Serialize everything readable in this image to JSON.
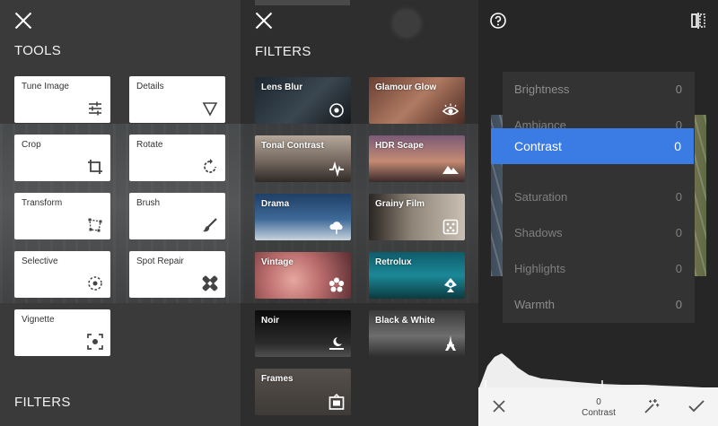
{
  "tools_panel": {
    "heading": "TOOLS",
    "footer_heading": "FILTERS",
    "tools": [
      {
        "label": "Tune Image",
        "icon": "sliders-icon"
      },
      {
        "label": "Details",
        "icon": "triangle-icon"
      },
      {
        "label": "Crop",
        "icon": "crop-icon"
      },
      {
        "label": "Rotate",
        "icon": "rotate-icon"
      },
      {
        "label": "Transform",
        "icon": "transform-icon"
      },
      {
        "label": "Brush",
        "icon": "brush-icon"
      },
      {
        "label": "Selective",
        "icon": "selective-icon"
      },
      {
        "label": "Spot Repair",
        "icon": "bandage-icon"
      },
      {
        "label": "Vignette",
        "icon": "vignette-icon"
      }
    ]
  },
  "filters_panel": {
    "heading": "FILTERS",
    "filters": [
      {
        "label": "Lens Blur",
        "icon": "lens-blur-icon"
      },
      {
        "label": "Glamour Glow",
        "icon": "eye-icon"
      },
      {
        "label": "Tonal Contrast",
        "icon": "pulse-icon"
      },
      {
        "label": "HDR Scape",
        "icon": "mountain-icon"
      },
      {
        "label": "Drama",
        "icon": "cloud-icon"
      },
      {
        "label": "Grainy Film",
        "icon": "grain-icon"
      },
      {
        "label": "Vintage",
        "icon": "flower-icon"
      },
      {
        "label": "Retrolux",
        "icon": "retrolux-icon"
      },
      {
        "label": "Noir",
        "icon": "moon-icon"
      },
      {
        "label": "Black & White",
        "icon": "eiffel-tower-icon"
      },
      {
        "label": "Frames",
        "icon": "frame-icon"
      }
    ]
  },
  "adjust_panel": {
    "items": [
      {
        "label": "Brightness",
        "value": "0"
      },
      {
        "label": "Ambiance",
        "value": "0"
      },
      {
        "label": "Contrast",
        "value": "0"
      },
      {
        "label": "Saturation",
        "value": "0"
      },
      {
        "label": "Shadows",
        "value": "0"
      },
      {
        "label": "Highlights",
        "value": "0"
      },
      {
        "label": "Warmth",
        "value": "0"
      }
    ],
    "active_item": "Contrast",
    "bottom": {
      "value": "0",
      "label": "Contrast"
    }
  },
  "colors": {
    "accent": "#3b7ce4",
    "card": "#ffffff",
    "panel_dark": "#2e2e2e"
  }
}
